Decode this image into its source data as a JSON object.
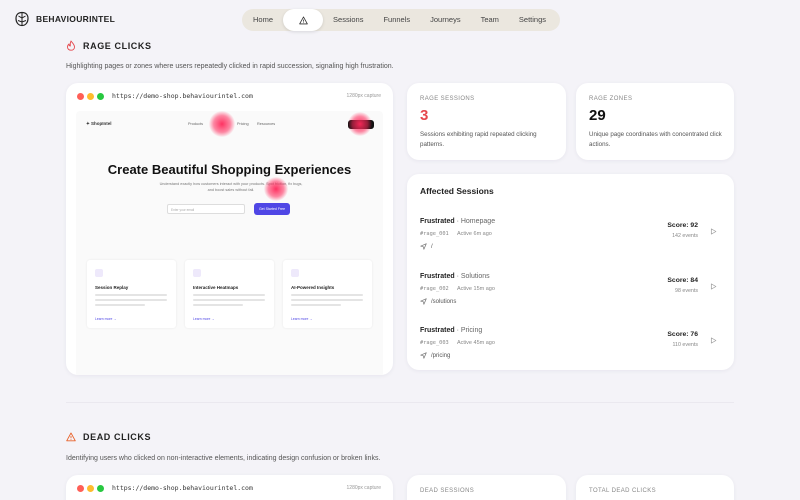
{
  "brand": {
    "name": "BEHAVIOURINTEL"
  },
  "nav": {
    "items": [
      "Home",
      "Sessions",
      "Funnels",
      "Journeys",
      "Team",
      "Settings"
    ],
    "alert_icon": "warning-triangle-icon"
  },
  "rage": {
    "title": "RAGE CLICKS",
    "description": "Highlighting pages or zones where users repeatedly clicked in rapid succession, signaling high frustration.",
    "browser": {
      "url": "https://demo-shop.behaviourintel.com",
      "capture": "1280px capture"
    },
    "site": {
      "logo": "✦ ShopIntel",
      "nav": [
        "Products",
        "Pricing",
        "Resources"
      ],
      "hero_title": "Create Beautiful Shopping Experiences",
      "hero_sub": "Understand exactly how customers interact with your products. Spot friction, fix bugs, and boost sales without fail.",
      "input_placeholder": "Enter your email",
      "cta": "Get Started Free",
      "features": [
        {
          "title": "Session Replay",
          "link": "Learn more →"
        },
        {
          "title": "Interactive Heatmaps",
          "link": "Learn more →"
        },
        {
          "title": "AI-Powered Insights",
          "link": "Learn more →"
        }
      ]
    },
    "stats": [
      {
        "label": "RAGE SESSIONS",
        "value": "3",
        "color": "#e5484d",
        "desc": "Sessions exhibiting rapid repeated clicking patterns."
      },
      {
        "label": "RAGE ZONES",
        "value": "29",
        "color": "#111111",
        "desc": "Unique page coordinates with concentrated click actions."
      }
    ],
    "affected": {
      "title": "Affected Sessions",
      "sessions": [
        {
          "status": "Frustrated",
          "page": " · Homepage",
          "id": "#rage_001",
          "ago": "Active 6m ago",
          "path": "/",
          "score": "Score: 92",
          "events": "142 events"
        },
        {
          "status": "Frustrated",
          "page": " · Solutions",
          "id": "#rage_002",
          "ago": "Active 15m ago",
          "path": "/solutions",
          "score": "Score: 84",
          "events": "98 events"
        },
        {
          "status": "Frustrated",
          "page": " · Pricing",
          "id": "#rage_003",
          "ago": "Active 45m ago",
          "path": "/pricing",
          "score": "Score: 76",
          "events": "110 events"
        }
      ]
    }
  },
  "dead": {
    "title": "DEAD CLICKS",
    "description": "Identifying users who clicked on non-interactive elements, indicating design confusion or broken links.",
    "browser": {
      "url": "https://demo-shop.behaviourintel.com",
      "capture": "1280px capture"
    },
    "stats": [
      {
        "label": "DEAD SESSIONS"
      },
      {
        "label": "TOTAL DEAD CLICKS"
      }
    ]
  },
  "colors": {
    "accent": "#4f46e5",
    "rage": "#e5484d",
    "dead_icon": "#e8622a"
  }
}
